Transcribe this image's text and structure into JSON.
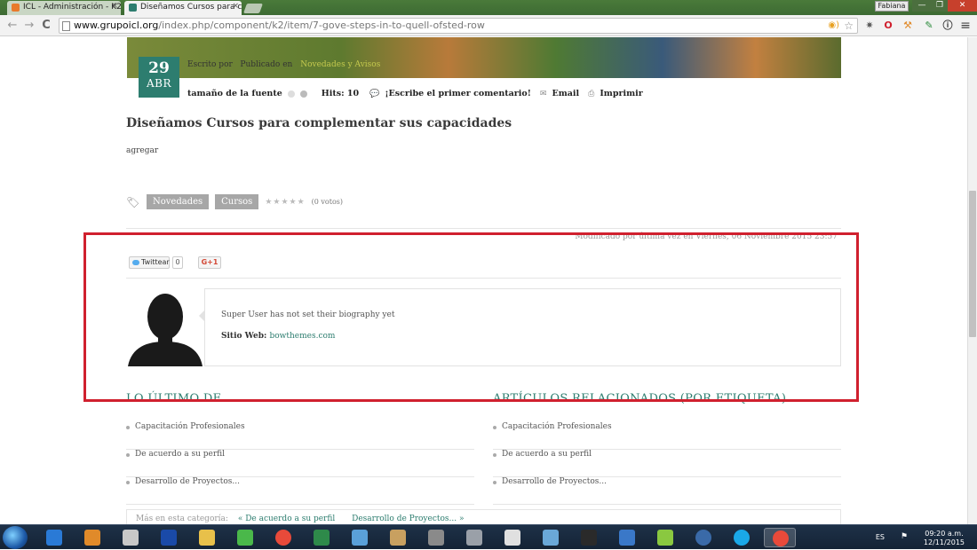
{
  "browser": {
    "tabs": [
      {
        "title": "ICL - Administración - K2",
        "favicon_color": "#e87a2c"
      },
      {
        "title": "Diseñamos Cursos para cu",
        "favicon_color": "#2d7d6f"
      }
    ],
    "profile_button": "Fabiana",
    "window_controls": {
      "minimize": "—",
      "restore": "❐",
      "close": "✕"
    },
    "nav": {
      "back": "←",
      "forward": "→",
      "reload": "C",
      "menu": "≡"
    },
    "address": {
      "host": "www.grupoicl.org",
      "path": "/index.php/component/k2/item/7-gove-steps-in-to-quell-ofsted-row"
    }
  },
  "article": {
    "date_day": "29",
    "date_month": "ABR",
    "written_by": "Escrito por",
    "published_in": "Publicado en",
    "category_link": "Novedades y Avisos",
    "font_size_label": "tamaño de la fuente",
    "hits": "Hits: 10",
    "comment_link": "¡Escribe el primer comentario!",
    "email_link": "Email",
    "print_link": "Imprimir",
    "title": "Diseñamos Cursos para complementar sus capacidades",
    "body": "agregar",
    "tags": [
      "Novedades",
      "Cursos"
    ],
    "rating_stars": "★★★★★",
    "votes": "(0 votos)",
    "modified": "Modificado por última vez en Viernes, 06 Noviembre 2015 23:57"
  },
  "share": {
    "twitter_label": "Twittear",
    "twitter_count": "0",
    "gplus_label": "G+1"
  },
  "author": {
    "bio": "Super User has not set their biography yet",
    "website_label": "Sitio Web:",
    "website_url": "bowthemes.com"
  },
  "latest": {
    "title": "LO ÚLTIMO DE",
    "items": [
      "Capacitación Profesionales",
      "De acuerdo a su perfil",
      "Desarrollo de Proyectos..."
    ]
  },
  "related": {
    "title": "ARTÍCULOS RELACIONADOS (POR ETIQUETA)",
    "items": [
      "Capacitación Profesionales",
      "De acuerdo a su perfil",
      "Desarrollo de Proyectos..."
    ]
  },
  "more": {
    "label": "Más en esta categoría:",
    "prev": "« De acuerdo a su perfil",
    "next": "Desarrollo de Proyectos... »"
  },
  "taskbar": {
    "language": "ES",
    "time": "09:20 a.m.",
    "date": "12/11/2015",
    "apps": [
      {
        "name": "internet-explorer",
        "color": "#2a7ad6"
      },
      {
        "name": "media-player",
        "color": "#e08a2a"
      },
      {
        "name": "snipping-tool",
        "color": "#c8c8c8"
      },
      {
        "name": "teamviewer",
        "color": "#1a4aa8"
      },
      {
        "name": "file-explorer",
        "color": "#e8c04a"
      },
      {
        "name": "calculator-grid",
        "color": "#4ab84a"
      },
      {
        "name": "chrome",
        "color": "#e84a3a"
      },
      {
        "name": "excel",
        "color": "#2e8a4a"
      },
      {
        "name": "network-map",
        "color": "#5aa0d8"
      },
      {
        "name": "notebook",
        "color": "#c8a060"
      },
      {
        "name": "usb-drive",
        "color": "#8a8a8a"
      },
      {
        "name": "server",
        "color": "#9aa0a8"
      },
      {
        "name": "document",
        "color": "#e0e0e0"
      },
      {
        "name": "network-tree",
        "color": "#6aa8d8"
      },
      {
        "name": "r-console",
        "color": "#2a2a2a"
      },
      {
        "name": "remote-desktop",
        "color": "#3a78c8"
      },
      {
        "name": "folder-green",
        "color": "#8ac840"
      },
      {
        "name": "thunderbird",
        "color": "#3a6aa8"
      },
      {
        "name": "skype",
        "color": "#1aa8e8"
      },
      {
        "name": "chrome-active",
        "color": "#e84a3a"
      }
    ]
  },
  "colors": {
    "accent": "#2d7d6f",
    "highlight_box": "#d0202e",
    "tag_bg": "#a7a7a7"
  }
}
